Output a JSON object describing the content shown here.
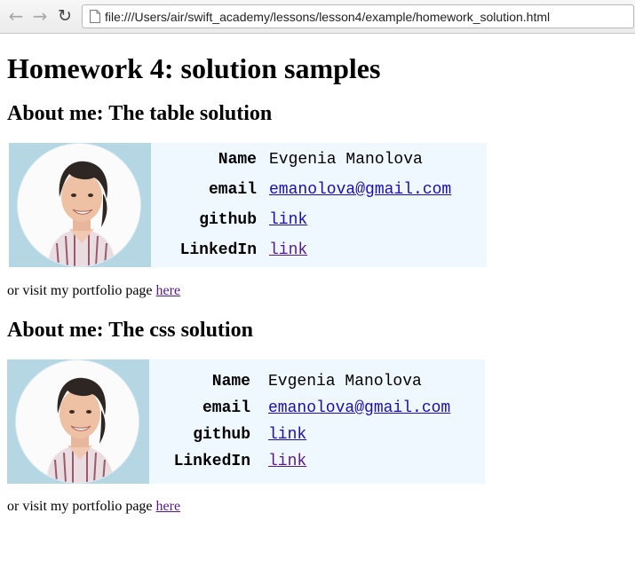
{
  "browser": {
    "back_icon": "arrow-left-icon",
    "forward_icon": "arrow-right-icon",
    "reload_icon": "reload-icon",
    "url": "file:///Users/air/swift_academy/lessons/lesson4/example/homework_solution.html"
  },
  "page": {
    "title": "Homework 4: solution samples",
    "section1": {
      "heading": "About me: The table solution",
      "rows": [
        {
          "label": "Name",
          "value": "Evgenia Manolova"
        },
        {
          "label": "email",
          "value": "emanolova@gmail.com"
        },
        {
          "label": "github",
          "value": "link"
        },
        {
          "label": "LinkedIn",
          "value": "link"
        }
      ],
      "visit_prefix": "or visit my portfolio page ",
      "visit_link": "here"
    },
    "section2": {
      "heading": "About me: The css solution",
      "rows": [
        {
          "label": "Name",
          "value": "Evgenia Manolova"
        },
        {
          "label": "email",
          "value": "emanolova@gmail.com"
        },
        {
          "label": "github",
          "value": "link"
        },
        {
          "label": "LinkedIn",
          "value": "link"
        }
      ],
      "visit_prefix": "or visit my portfolio page ",
      "visit_link": "here"
    }
  },
  "colors": {
    "card_bg": "#f0f8ff",
    "photo_bg": "#b5d7e4",
    "link": "#1a0dab",
    "visited": "#551a8b"
  }
}
